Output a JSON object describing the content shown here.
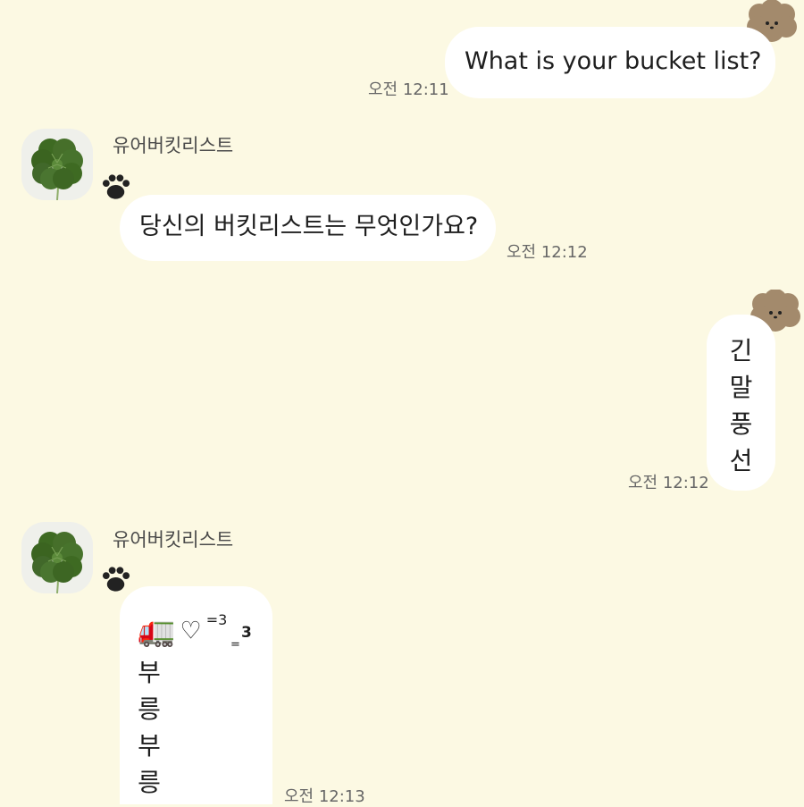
{
  "messages": [
    {
      "text": "What is your bucket list?",
      "time": "오전 12:11",
      "sender": "me"
    },
    {
      "sender_name": "유어버킷리스트",
      "text": "당신의 버킷리스트는 무엇인가요?",
      "time": "오전 12:12"
    },
    {
      "sender": "me",
      "chars": [
        "긴",
        "말",
        "풍",
        "선"
      ],
      "time": "오전 12:12"
    },
    {
      "sender_name": "유어버킷리스트",
      "top_line": {
        "emoji": "🚛",
        "heart": "♡",
        "sup": "=3",
        "sub": "=",
        "tail": "3"
      },
      "chars": [
        "부",
        "릉",
        "부",
        "릉"
      ],
      "time": "오전 12:13"
    }
  ],
  "icons": {
    "avatar": "four-leaf-clover-icon",
    "paw": "paw-icon",
    "sticker": "poodle-icon"
  },
  "colors": {
    "background": "#fcf9e3",
    "bubble": "#ffffff",
    "clover": "#3e6a22",
    "paw": "#222222",
    "poodle": "#a38a6c"
  }
}
